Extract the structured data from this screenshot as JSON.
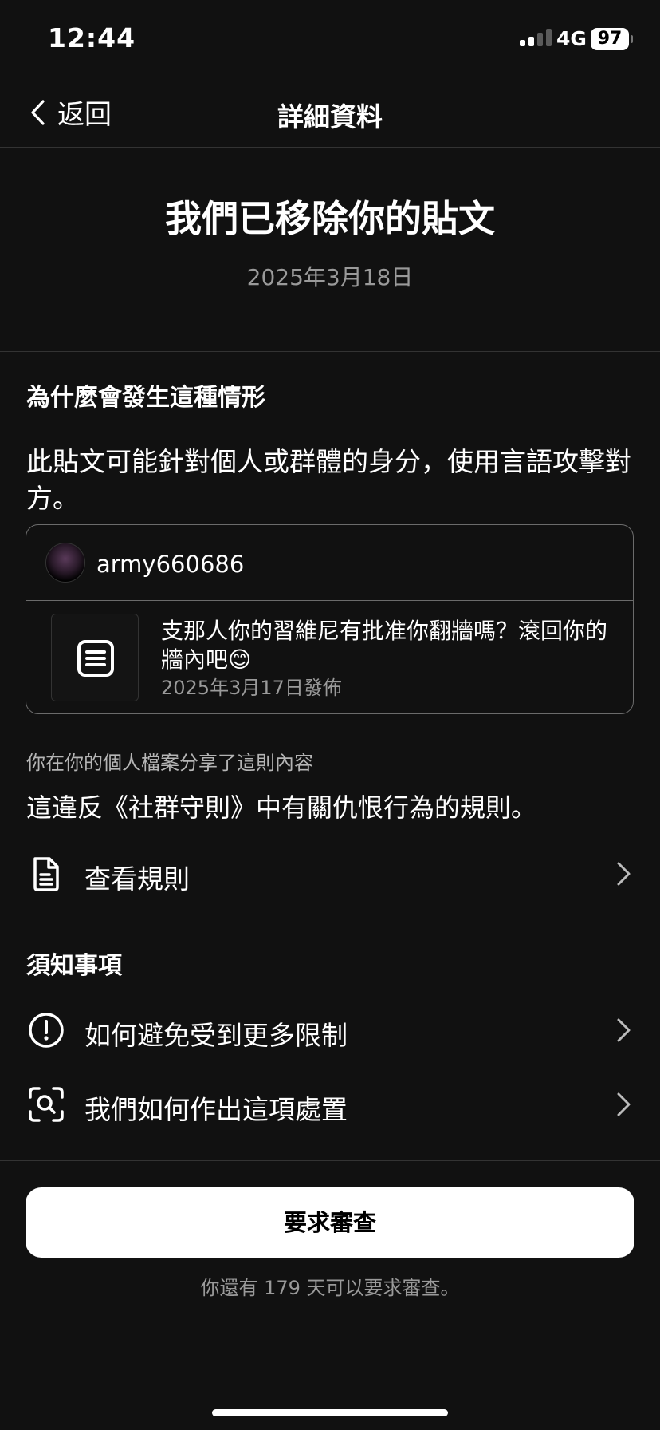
{
  "status_bar": {
    "time": "12:44",
    "network": "4G",
    "battery": "97"
  },
  "nav": {
    "back_label": "返回",
    "title": "詳細資料"
  },
  "header": {
    "headline": "我們已移除你的貼文",
    "date": "2025年3月18日"
  },
  "why": {
    "title": "為什麼會發生這種情形",
    "reason": "此貼文可能針對個人或群體的身分，使用言語攻擊對方。"
  },
  "post": {
    "username": "army660686",
    "text": "支那人你的習維尼有批准你翻牆嗎？滾回你的牆內吧😊",
    "posted_date": "2025年3月17日發佈"
  },
  "shared_note": "你在你的個人檔案分享了這則內容",
  "violation": "這違反《社群守則》中有關仇恨行為的規則。",
  "view_rules_label": "查看規則",
  "notes": {
    "title": "須知事項",
    "items": [
      {
        "label": "如何避免受到更多限制",
        "icon": "alert-circle-icon"
      },
      {
        "label": "我們如何作出這項處置",
        "icon": "scan-search-icon"
      }
    ]
  },
  "review": {
    "button_label": "要求審查",
    "footnote": "你還有 179 天可以要求審查。"
  }
}
